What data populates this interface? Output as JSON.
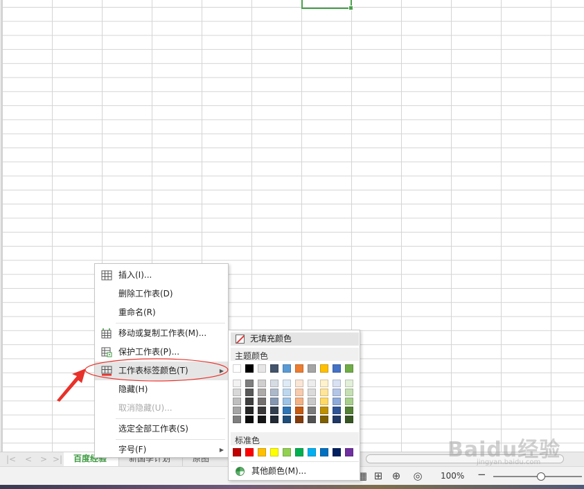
{
  "sheet_tabs": [
    {
      "label": "百度经验",
      "active": true
    },
    {
      "label": "新国季计划",
      "active": false
    },
    {
      "label": "原图",
      "active": false
    }
  ],
  "context_menu": {
    "items": [
      {
        "label": "插入(I)...",
        "icon": "insert-table-icon",
        "state": "normal"
      },
      {
        "label": "删除工作表(D)",
        "icon": "",
        "state": "normal"
      },
      {
        "label": "重命名(R)",
        "icon": "",
        "state": "normal"
      },
      {
        "label": "移动或复制工作表(M)...",
        "icon": "move-copy-sheet-icon",
        "state": "normal"
      },
      {
        "label": "保护工作表(P)...",
        "icon": "protect-sheet-icon",
        "state": "normal"
      },
      {
        "label": "工作表标签颜色(T)",
        "icon": "tab-color-icon",
        "state": "hover",
        "submenu": true
      },
      {
        "label": "隐藏(H)",
        "icon": "",
        "state": "normal"
      },
      {
        "label": "取消隐藏(U)...",
        "icon": "",
        "state": "disabled"
      },
      {
        "label": "选定全部工作表(S)",
        "icon": "",
        "state": "normal"
      },
      {
        "label": "字号(F)",
        "icon": "",
        "state": "normal",
        "submenu": true
      }
    ]
  },
  "color_submenu": {
    "no_fill_label": "无填充颜色",
    "theme_label": "主题颜色",
    "standard_label": "标准色",
    "more_label": "其他颜色(M)...",
    "theme_colors": [
      "#ffffff",
      "#000000",
      "#e7e6e6",
      "#44546a",
      "#5b9bd5",
      "#ed7d31",
      "#a5a5a5",
      "#ffc000",
      "#4472c4",
      "#70ad47"
    ],
    "theme_shades": [
      [
        "#f2f2f2",
        "#7f7f7f",
        "#d0cece",
        "#d6dce4",
        "#deebf6",
        "#fbe5d5",
        "#ededed",
        "#fff2cc",
        "#d9e2f3",
        "#e2efd9"
      ],
      [
        "#d8d8d8",
        "#595959",
        "#aeaaaa",
        "#acb9ca",
        "#bdd7ee",
        "#f7cbac",
        "#dbdbdb",
        "#fee599",
        "#b4c6e7",
        "#c5e0b3"
      ],
      [
        "#bfbfbf",
        "#3f3f3f",
        "#757070",
        "#8496b0",
        "#9dc3e6",
        "#f4b183",
        "#c9c9c9",
        "#ffd965",
        "#8eaadb",
        "#a8d08d"
      ],
      [
        "#a5a5a5",
        "#262626",
        "#3a3838",
        "#323f4f",
        "#2e75b5",
        "#c55a11",
        "#7b7b7b",
        "#bf9000",
        "#2f5496",
        "#538135"
      ],
      [
        "#7f7f7f",
        "#0c0c0c",
        "#171616",
        "#222a35",
        "#1e4e79",
        "#833c0b",
        "#525252",
        "#7f6000",
        "#1f3864",
        "#375623"
      ]
    ],
    "standard_colors": [
      "#c00000",
      "#ff0000",
      "#ffc000",
      "#ffff00",
      "#92d050",
      "#00b050",
      "#00b0f0",
      "#0070c0",
      "#002060",
      "#7030a0"
    ]
  },
  "status_bar": {
    "zoom": "100%"
  },
  "annotation_color": "#e8312a",
  "watermark": {
    "brand": "Baidu经验",
    "url": "jingyan.baidu.com"
  }
}
